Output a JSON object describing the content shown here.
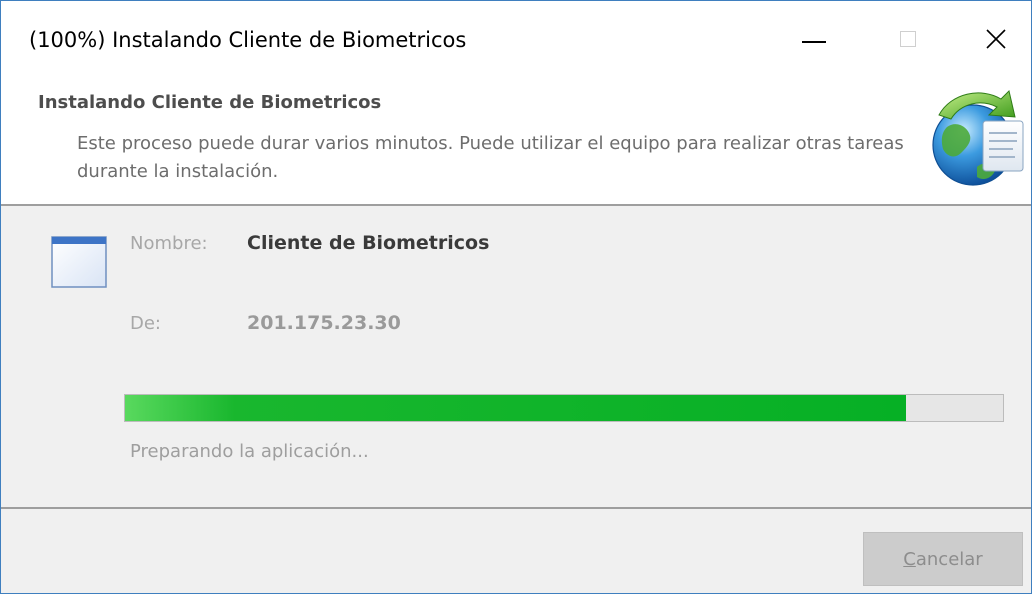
{
  "window": {
    "title": "(100%) Instalando Cliente de Biometricos"
  },
  "titlebar_buttons": {
    "minimize_icon": "minimize-icon",
    "maximize_icon": "maximize-icon",
    "close_glyph": "✕"
  },
  "header": {
    "title": "Instalando Cliente de Biometricos",
    "description": "Este proceso puede durar varios minutos. Puede utilizar el equipo para realizar otras tareas durante la instalación.",
    "icon": "globe-install-icon"
  },
  "details": {
    "app_icon": "application-window-icon",
    "name_label": "Nombre:",
    "name_value": "Cliente de Biometricos",
    "from_label": "De:",
    "from_value": "201.175.23.30"
  },
  "progress": {
    "fraction": 0.89,
    "color": "#06b025",
    "status": "Preparando la aplicación..."
  },
  "footer": {
    "cancel_accel": "C",
    "cancel_rest": "ancelar",
    "cancel_enabled": false
  }
}
